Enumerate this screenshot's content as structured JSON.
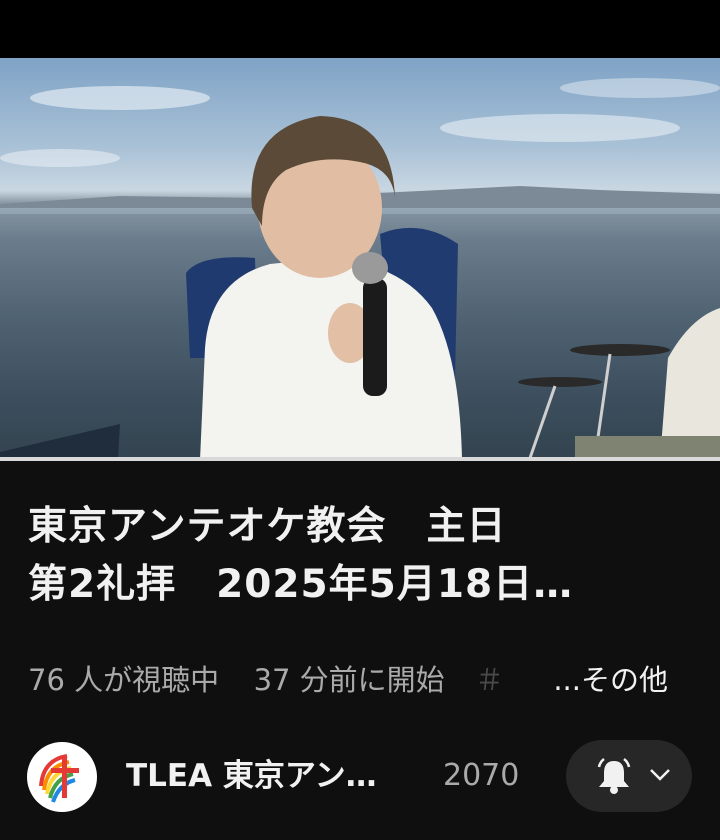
{
  "video": {
    "description": ""
  },
  "title": {
    "line1": "東京アンテオケ教会　主日",
    "line2": "第2礼拝　2025年5月18日…"
  },
  "meta": {
    "viewers": "76 人が視聴中",
    "started": "37 分前に開始",
    "hashtag": "＃",
    "more": "...その他"
  },
  "channel": {
    "name": "TLEA 東京アン…",
    "subscribers": "2070"
  },
  "icons": {
    "avatar": "church-logo-icon",
    "bell": "bell-icon",
    "chevron": "chevron-down-icon"
  },
  "colors": {
    "background": "#0f0f0f",
    "pill": "#272727",
    "secondary_text": "#aaaaaa"
  }
}
